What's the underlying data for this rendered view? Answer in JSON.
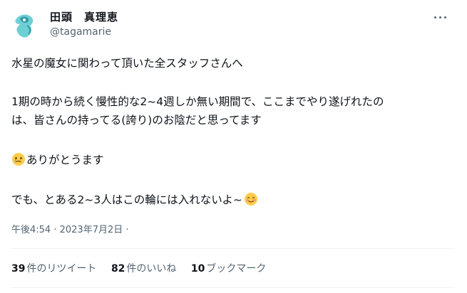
{
  "user": {
    "display_name": "田頭　真理恵",
    "handle": "@tagamarie",
    "avatar_icon": "avatar-illustration",
    "accent_color": "#4fc3c9"
  },
  "tweet": {
    "line1": "水星の魔女に関わって頂いた全スタッフさんへ",
    "line2a": "1期の時から続く慢性的な2~4週しか無い期間で、ここまでやり遂げれたの",
    "line2b": "は、皆さんの持ってる(誇り)のお陰だと思ってます",
    "line3": "ありがとうます",
    "line3_emoji": "face-holding-back-tears",
    "line4": "でも、とある2~3人はこの輪には入れないよ~",
    "line4_emoji": "smiling-face-with-blush"
  },
  "meta": {
    "time": "午後4:54",
    "separator": " · ",
    "date": "2023年7月2日",
    "trailing": " ·"
  },
  "stats": {
    "retweets_count": "39",
    "retweets_label": "件のリツイート",
    "likes_count": "82",
    "likes_label": "件のいいね",
    "bookmarks_count": "10",
    "bookmarks_label": "ブックマーク"
  },
  "more_icon": "more-horizontal-icon"
}
